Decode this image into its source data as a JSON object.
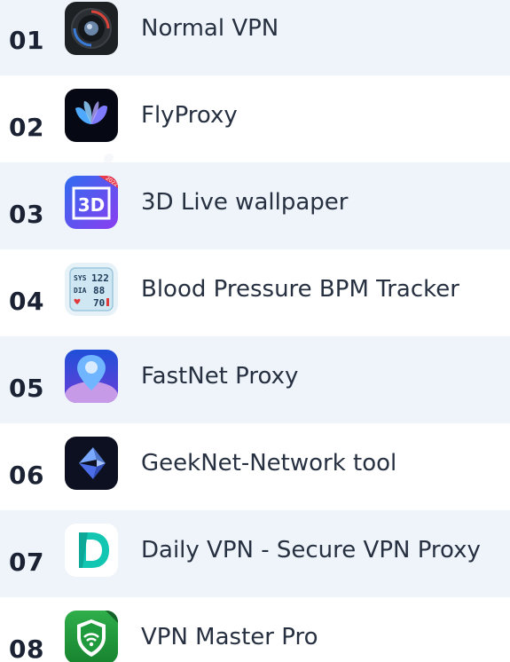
{
  "apps": [
    {
      "rank": "01",
      "name": "Normal VPN",
      "icon": "normal-vpn-icon"
    },
    {
      "rank": "02",
      "name": "FlyProxy",
      "icon": "flyproxy-icon"
    },
    {
      "rank": "03",
      "name": "3D Live wallpaper",
      "icon": "3d-live-wallpaper-icon"
    },
    {
      "rank": "04",
      "name": "Blood Pressure BPM Tracker",
      "icon": "blood-pressure-icon"
    },
    {
      "rank": "05",
      "name": "FastNet Proxy",
      "icon": "fastnet-proxy-icon"
    },
    {
      "rank": "06",
      "name": "GeekNet-Network tool",
      "icon": "geeknet-icon"
    },
    {
      "rank": "07",
      "name": "Daily VPN - Secure VPN Proxy",
      "icon": "daily-vpn-icon"
    },
    {
      "rank": "08",
      "name": "VPN Master Pro",
      "icon": "vpn-master-pro-icon"
    }
  ],
  "colors": {
    "row_alt_bg": "#eef4fa",
    "rank_text": "#1a2233",
    "name_text": "#263040"
  }
}
